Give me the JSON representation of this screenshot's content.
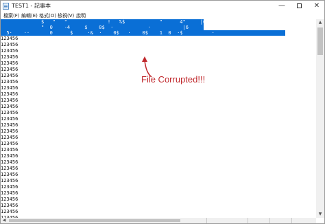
{
  "window": {
    "title": "TEST1 - 記事本",
    "minimize_symbol": "—",
    "close_symbol": "✕"
  },
  "menu": {
    "items": [
      {
        "label": "檔案(F)"
      },
      {
        "label": "編輯(E)"
      },
      {
        "label": "格式(O)"
      },
      {
        "label": "檢視(V)"
      },
      {
        "label": "說明"
      }
    ]
  },
  "editor": {
    "corrupted_lines": [
      "              $   \"   \"              !   %$            \"      4\"     |6",
      "              \"  0    -4     $    0$  ·            ·           |6",
      "  5·    ··       0      $     ·&  ·    0$   ·    0$    1  0  ·$          ·"
    ],
    "repeated_line": "123456",
    "repeated_count": 31
  },
  "annotation": {
    "text": "File Corrupted!!!",
    "color": "#c0282c"
  },
  "colors": {
    "selection": "#0a6fd6",
    "annotation": "#c0282c"
  }
}
